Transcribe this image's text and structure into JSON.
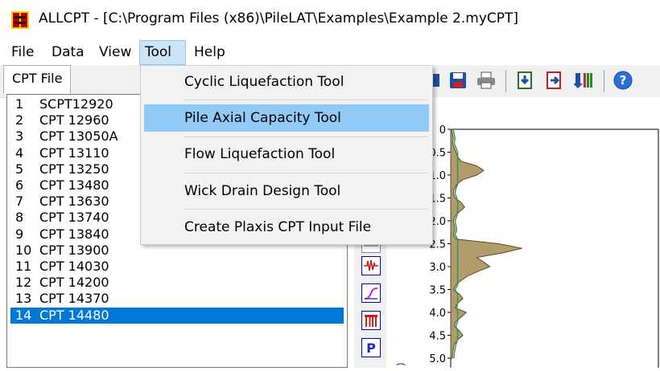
{
  "window": {
    "title": "ALLCPT - [C:\\Program Files (x86)\\PileLAT\\Examples\\Example 2.myCPT]"
  },
  "menu": {
    "file": "File",
    "data": "Data",
    "view": "View",
    "tool": "Tool",
    "help": "Help"
  },
  "left_panel": {
    "tab_label": "CPT File",
    "items": [
      {
        "num": "1",
        "name": "SCPT12920"
      },
      {
        "num": "2",
        "name": "CPT 12960"
      },
      {
        "num": "3",
        "name": "CPT 13050A"
      },
      {
        "num": "4",
        "name": "CPT 13110"
      },
      {
        "num": "5",
        "name": "CPT 13250"
      },
      {
        "num": "6",
        "name": "CPT 13480"
      },
      {
        "num": "7",
        "name": "CPT 13630"
      },
      {
        "num": "8",
        "name": "CPT 13740"
      },
      {
        "num": "9",
        "name": "CPT 13840"
      },
      {
        "num": "10",
        "name": "CPT 13900"
      },
      {
        "num": "11",
        "name": "CPT 14030"
      },
      {
        "num": "12",
        "name": "CPT 14200"
      },
      {
        "num": "13",
        "name": "CPT 14370"
      },
      {
        "num": "14",
        "name": "CPT 14480"
      }
    ],
    "selected_index": 13
  },
  "tool_menu": {
    "items": [
      "Cyclic Liquefaction Tool",
      "Pile Axial Capacity Tool",
      "Flow Liquefaction Tool",
      "Wick Drain Design Tool",
      "Create Plaxis CPT Input File"
    ],
    "hovered_index": 1
  },
  "side_tools": {
    "p_label": "P"
  },
  "chart_data": {
    "type": "area",
    "y_ticks": [
      "0",
      "0.5",
      "1.0",
      "1.5",
      "2.0",
      "2.5",
      "3.0",
      "3.5",
      "4.0",
      "4.5",
      "5.0"
    ],
    "ylim": [
      0,
      5.0
    ],
    "y_inverted": true,
    "fill_color": "#b39c6b",
    "series": [
      {
        "y": [
          0.0,
          0.1,
          0.2,
          0.3,
          0.4,
          0.5,
          0.6,
          0.7,
          0.8,
          0.9,
          1.0,
          1.1,
          1.2,
          1.3,
          1.4,
          1.5,
          1.6,
          1.7,
          1.8,
          1.9,
          2.0,
          2.1,
          2.2,
          2.3,
          2.4,
          2.5,
          2.6,
          2.7,
          2.8,
          2.9,
          3.0,
          3.1,
          3.2,
          3.3,
          3.4,
          3.5,
          3.6,
          3.7,
          3.8,
          3.9,
          4.0,
          4.1,
          4.2,
          4.3,
          4.4,
          4.5,
          4.6,
          4.7,
          4.8,
          4.9,
          5.0
        ],
        "x": [
          1,
          2,
          3,
          2,
          4,
          6,
          8,
          12,
          30,
          38,
          30,
          14,
          7,
          4,
          3,
          5,
          12,
          16,
          10,
          5,
          3,
          4,
          5,
          3,
          6,
          55,
          82,
          60,
          30,
          38,
          45,
          32,
          20,
          12,
          6,
          3,
          10,
          14,
          8,
          5,
          18,
          12,
          6,
          4,
          10,
          14,
          8,
          4,
          3,
          2,
          2
        ]
      }
    ]
  }
}
